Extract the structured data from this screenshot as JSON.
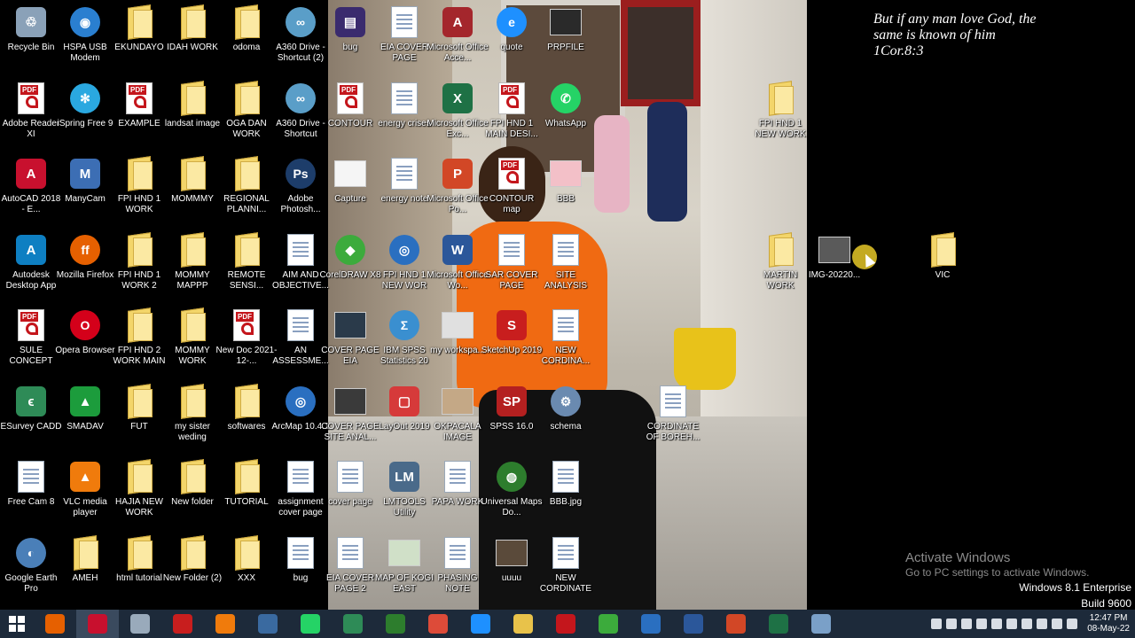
{
  "verse": {
    "line1": "But if any man love God, the",
    "line2": "same is known of him",
    "line3": "1Cor.8:3"
  },
  "watermark": {
    "title": "Activate Windows",
    "subtitle": "Go to PC settings to activate Windows.",
    "edition": "Windows 8.1 Enterprise",
    "build": "Build 9600"
  },
  "clock": {
    "time": "12:47 PM",
    "date": "08-May-22"
  },
  "icons": [
    {
      "label": "Recycle Bin"
    },
    {
      "label": "HSPA USB Modem"
    },
    {
      "label": "EKUNDAYO"
    },
    {
      "label": "IDAH WORK"
    },
    {
      "label": "odoma"
    },
    {
      "label": "A360 Drive - Shortcut (2)"
    },
    {
      "label": "Adobe Reader XI"
    },
    {
      "label": "iSpring Free 9"
    },
    {
      "label": "EXAMPLE"
    },
    {
      "label": "landsat image"
    },
    {
      "label": "OGA DAN WORK"
    },
    {
      "label": "A360 Drive - Shortcut"
    },
    {
      "label": "AutoCAD 2018 - E..."
    },
    {
      "label": "ManyCam"
    },
    {
      "label": "FPI HND 1 WORK"
    },
    {
      "label": "MOMMMY"
    },
    {
      "label": "REGIONAL PLANNI..."
    },
    {
      "label": "Adobe Photosh..."
    },
    {
      "label": "Autodesk Desktop App"
    },
    {
      "label": "Mozilla Firefox"
    },
    {
      "label": "FPI HND 1 WORK 2"
    },
    {
      "label": "MOMMY MAPPP"
    },
    {
      "label": "REMOTE SENSI..."
    },
    {
      "label": "AIM AND OBJECTIVE..."
    },
    {
      "label": "SULE CONCEPT"
    },
    {
      "label": "Opera Browser"
    },
    {
      "label": "FPI HND 2 WORK MAIN"
    },
    {
      "label": "MOMMY WORK"
    },
    {
      "label": "New Doc 2021-12-..."
    },
    {
      "label": "AN ASSESSME..."
    },
    {
      "label": "ESurvey CADD"
    },
    {
      "label": "SMADAV"
    },
    {
      "label": "FUT"
    },
    {
      "label": "my sister weding"
    },
    {
      "label": "softwares"
    },
    {
      "label": "ArcMap 10.4.1"
    },
    {
      "label": "Free Cam 8"
    },
    {
      "label": "VLC media player"
    },
    {
      "label": "HAJIA NEW WORK"
    },
    {
      "label": "New folder"
    },
    {
      "label": "TUTORIAL"
    },
    {
      "label": "assignment cover page"
    },
    {
      "label": "Google Earth Pro"
    },
    {
      "label": "AMEH"
    },
    {
      "label": "html tutorial"
    },
    {
      "label": "New Folder (2)"
    },
    {
      "label": "XXX"
    },
    {
      "label": "bug"
    },
    {
      "label": "bug"
    },
    {
      "label": "EIA COVER PAGE"
    },
    {
      "label": "Microsoft Office Acce..."
    },
    {
      "label": "quote"
    },
    {
      "label": "PRPFILE"
    },
    {
      "label": "CONTOUR"
    },
    {
      "label": "energy crises"
    },
    {
      "label": "Microsoft Office Exc..."
    },
    {
      "label": "FPI HND 1 MAIN DESI..."
    },
    {
      "label": "WhatsApp"
    },
    {
      "label": "Capture"
    },
    {
      "label": "energy note"
    },
    {
      "label": "Microsoft Office Po..."
    },
    {
      "label": "CONTOUR map"
    },
    {
      "label": "BBB"
    },
    {
      "label": "CorelDRAW X8"
    },
    {
      "label": "FPI HND 1 NEW WOR"
    },
    {
      "label": "Microsoft Office Wo..."
    },
    {
      "label": "SAR COVER PAGE"
    },
    {
      "label": "SITE ANALYSIS"
    },
    {
      "label": "COVER PAGE EIA"
    },
    {
      "label": "IBM SPSS Statistics 20"
    },
    {
      "label": "my workspa..."
    },
    {
      "label": "SketchUp 2019"
    },
    {
      "label": "NEW CORDINA..."
    },
    {
      "label": "COVER PAGE SITE ANAL..."
    },
    {
      "label": "LayOut 2019"
    },
    {
      "label": "OKPACALA IMAGE"
    },
    {
      "label": "SPSS 16.0"
    },
    {
      "label": "schema"
    },
    {
      "label": "CORDINATE OF BOREH..."
    },
    {
      "label": "cover page"
    },
    {
      "label": "LMTOOLS Utility"
    },
    {
      "label": "PAPA WORK"
    },
    {
      "label": "Universal Maps Do..."
    },
    {
      "label": "BBB.jpg"
    },
    {
      "label": "EIA COVER PAGE 2"
    },
    {
      "label": "MAP OF KOGI EAST"
    },
    {
      "label": "PHASING NOTE"
    },
    {
      "label": "uuuu"
    },
    {
      "label": "NEW CORDINATE"
    },
    {
      "label": "FPI HND 1 NEW WORK"
    },
    {
      "label": "MARTIN WORK"
    },
    {
      "label": "IMG-20220..."
    },
    {
      "label": "VIC"
    }
  ],
  "taskbar": {
    "apps": [
      "firefox-icon",
      "autocad-icon",
      "google-earth-icon",
      "sketchup-icon",
      "vlc-icon",
      "arcmap-icon",
      "whatsapp-icon",
      "esurvey-icon",
      "universal-maps-icon",
      "chrome-icon",
      "ie-icon",
      "explorer-icon",
      "acrobat-icon",
      "coreldraw-icon",
      "arcgis-icon",
      "word-icon",
      "powerpoint-icon",
      "excel-icon",
      "screen-icon"
    ]
  }
}
